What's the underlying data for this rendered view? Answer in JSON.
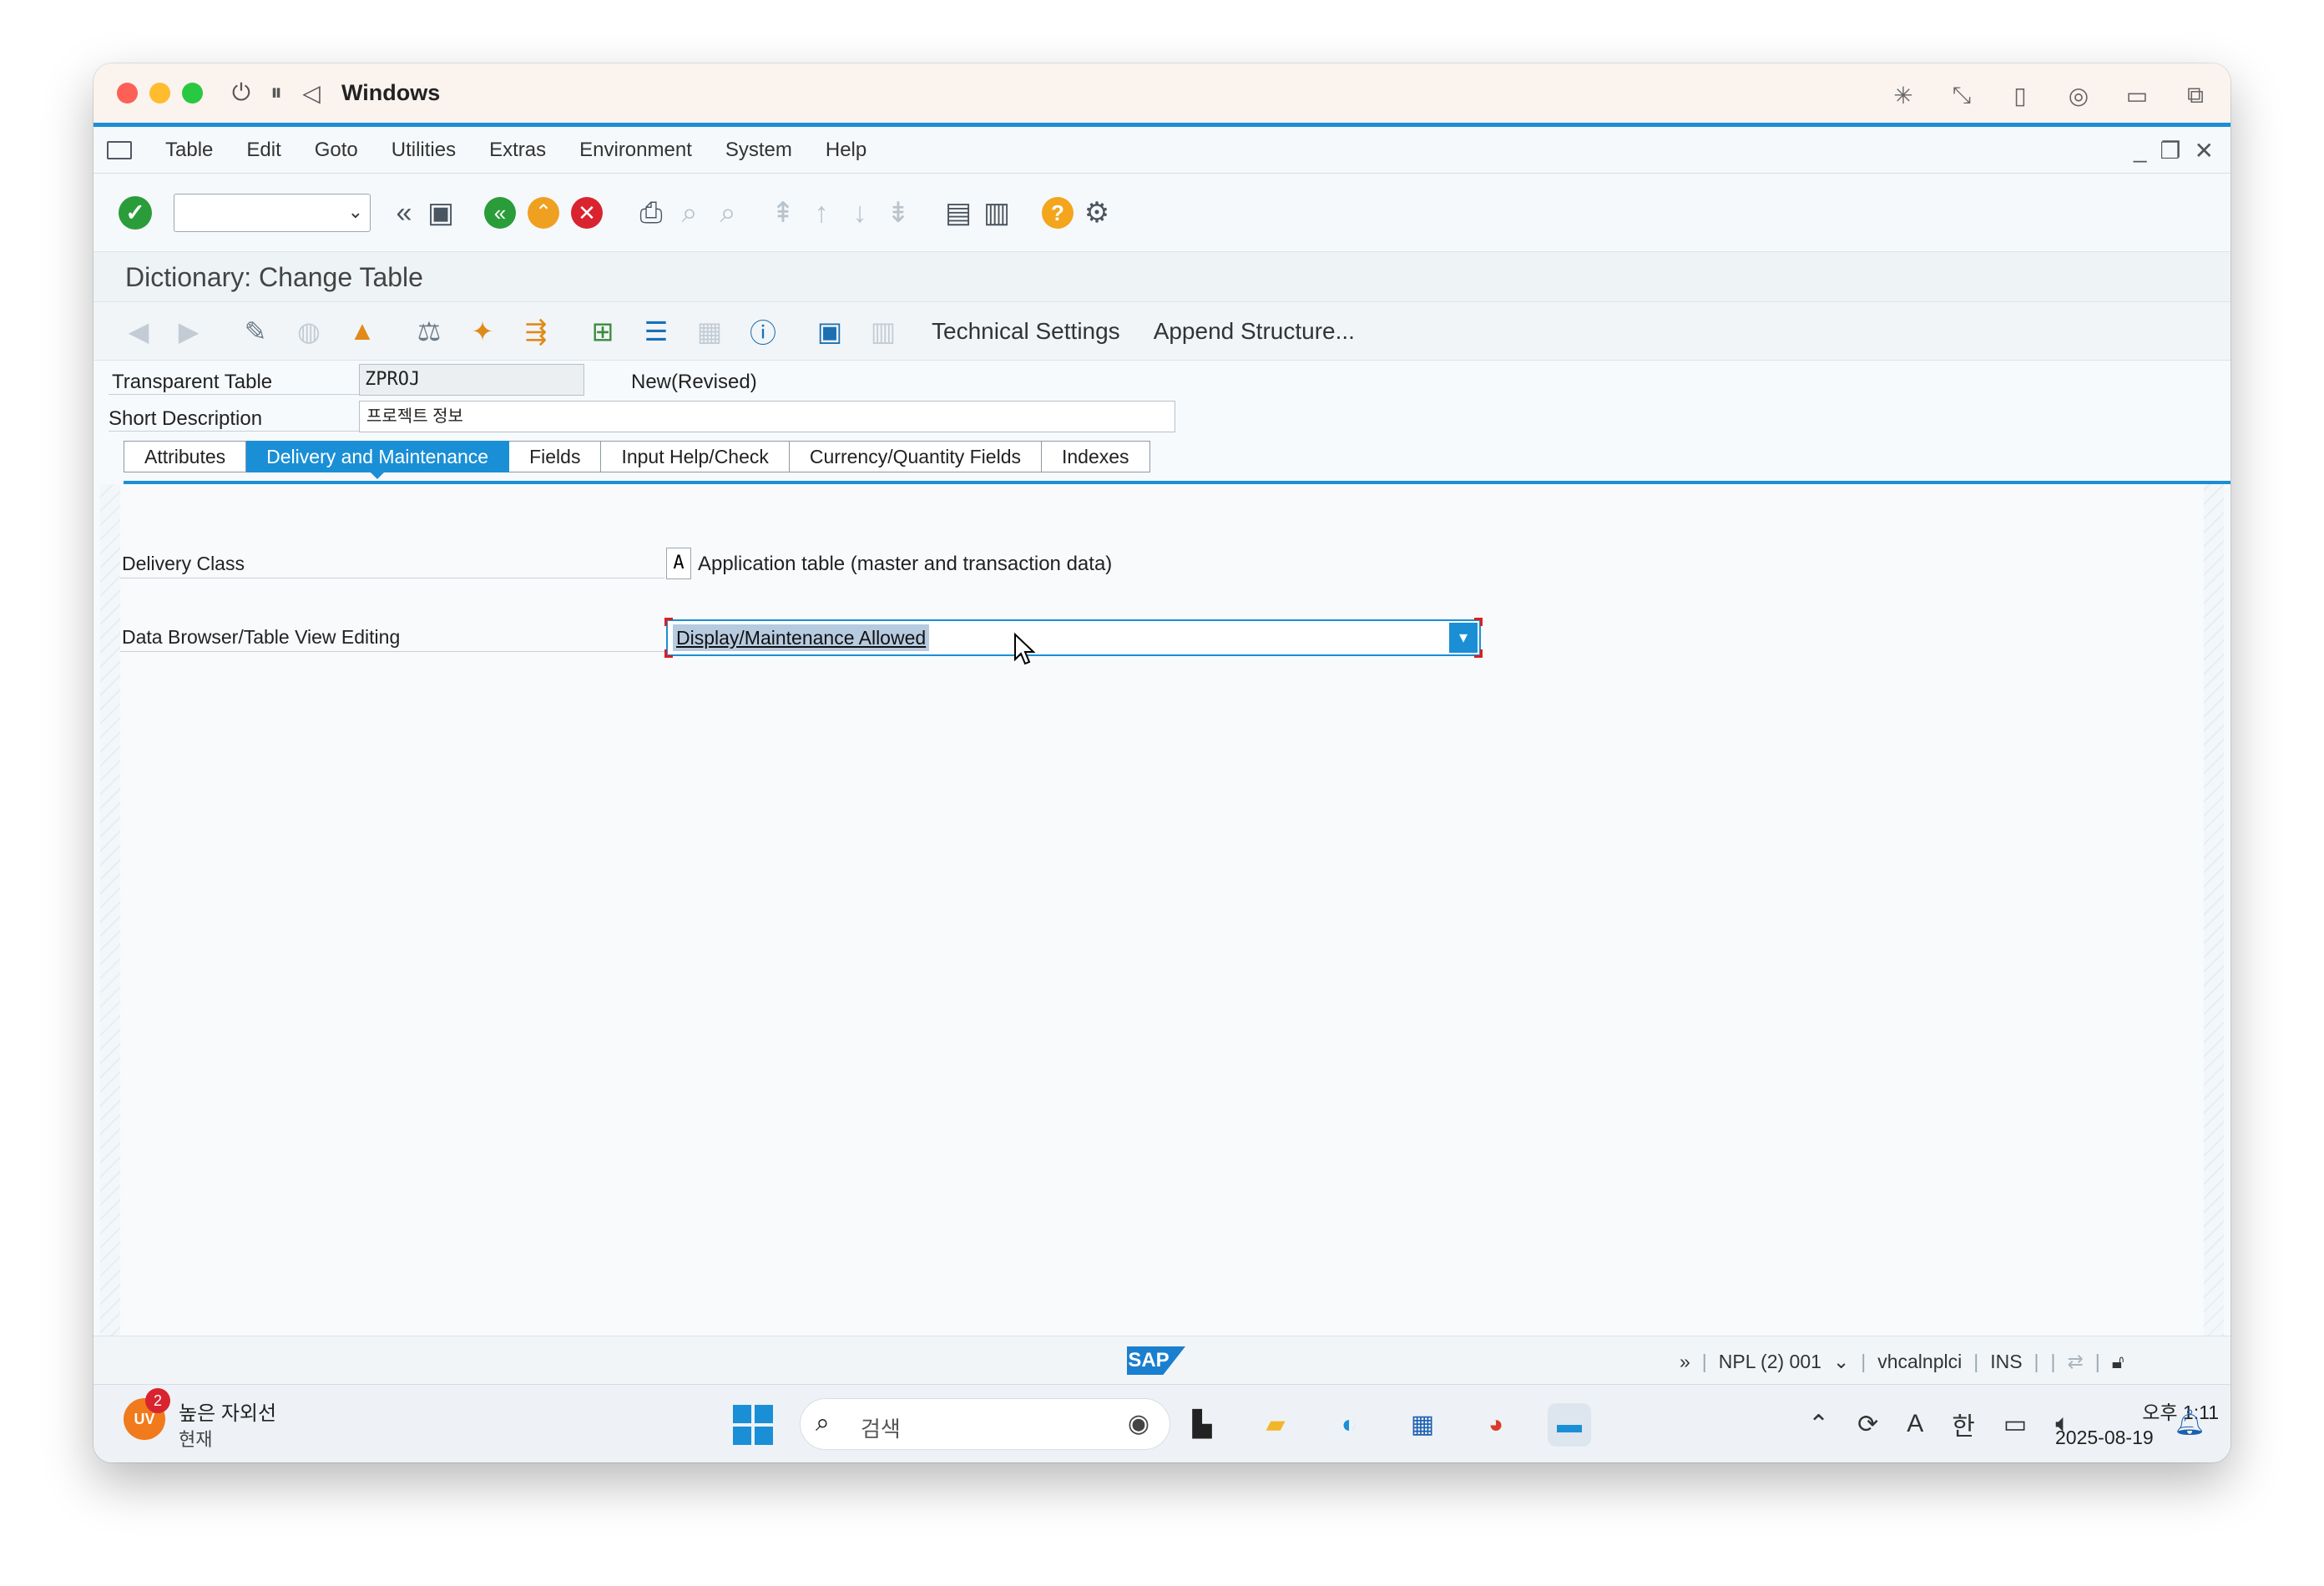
{
  "window": {
    "title": "Windows"
  },
  "menu": {
    "items": [
      "Table",
      "Edit",
      "Goto",
      "Utilities",
      "Extras",
      "Environment",
      "System",
      "Help"
    ]
  },
  "page": {
    "title": "Dictionary: Change Table"
  },
  "app_toolbar": {
    "technical_settings": "Technical Settings",
    "append_structure": "Append Structure..."
  },
  "header": {
    "transparent_table_label": "Transparent Table",
    "table_name": "ZPROJ",
    "status": "New(Revised)",
    "short_description_label": "Short Description",
    "short_description": "프로젝트 정보"
  },
  "tabs": [
    {
      "label": "Attributes",
      "active": false
    },
    {
      "label": "Delivery and Maintenance",
      "active": true
    },
    {
      "label": "Fields",
      "active": false
    },
    {
      "label": "Input Help/Check",
      "active": false
    },
    {
      "label": "Currency/Quantity Fields",
      "active": false
    },
    {
      "label": "Indexes",
      "active": false
    }
  ],
  "delivery": {
    "delivery_class_label": "Delivery Class",
    "delivery_class_code": "A",
    "delivery_class_desc": "Application table (master and transaction data)",
    "browser_label": "Data Browser/Table View Editing",
    "browser_value": "Display/Maintenance Allowed"
  },
  "status_bar": {
    "logo": "SAP",
    "system": "NPL (2) 001",
    "host": "vhcalnplci",
    "mode": "INS"
  },
  "taskbar": {
    "weather_badge": "2",
    "weather_icon": "UV",
    "weather_line1": "높은 자외선",
    "weather_line2": "현재",
    "search_placeholder": "검색",
    "ime": "한",
    "time": "오후 1:11",
    "date": "2025-08-19"
  },
  "colors": {
    "accent": "#1a8fd6",
    "ok_green": "#2a9d3a",
    "cancel_red": "#d9242f"
  }
}
